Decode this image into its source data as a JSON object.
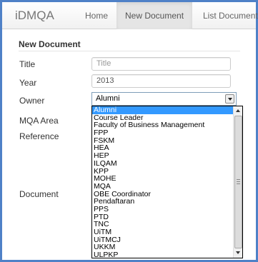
{
  "navbar": {
    "brand": "iDMQA",
    "items": [
      {
        "label": "Home",
        "active": false
      },
      {
        "label": "New Document",
        "active": true
      },
      {
        "label": "List Document",
        "active": false
      }
    ]
  },
  "form": {
    "heading": "New Document",
    "title": {
      "label": "Title",
      "placeholder": "Title",
      "value": ""
    },
    "year": {
      "label": "Year",
      "value": "2013"
    },
    "owner": {
      "label": "Owner",
      "selected": "Alumni",
      "options": [
        "Alumni",
        "Course Leader",
        "Faculty of Business Management",
        "FPP",
        "FSKM",
        "HEA",
        "HEP",
        "ILQAM",
        "KPP",
        "MOHE",
        "MQA",
        "OBE Coordinator",
        "Pendaftaran",
        "PPS",
        "PTD",
        "TNC",
        "UiTM",
        "UiTMCJ",
        "UKKM",
        "ULPKP"
      ]
    },
    "mqa_area_label": "MQA Area",
    "reference_label": "Reference",
    "document_label": "Document"
  },
  "colors": {
    "frame_border": "#4f81c7",
    "selected_option": "#3399ff"
  }
}
